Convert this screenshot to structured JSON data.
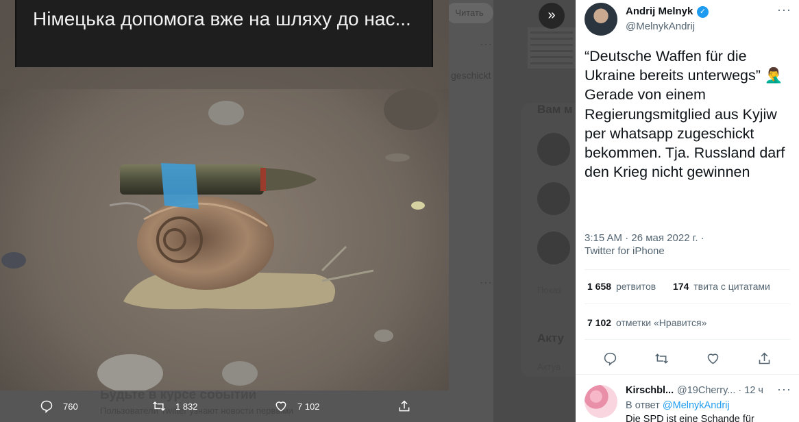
{
  "background": {
    "read_button": "Читать",
    "sidebar_heading": "Вам м",
    "trends_heading": "Акту",
    "fragment_1": "Показ",
    "fragment_2": "Актуа",
    "fragment_3": "geschickt",
    "bottom_title": "Будьте в курсе событий",
    "bottom_sub": "Пользователи Twitter узнают новости первыми"
  },
  "media": {
    "caption": "Німецька допомога вже на шляху до нас...",
    "image_icon": "snail-with-bullet-photo",
    "actions": {
      "reply_count": "760",
      "retweet_count": "1 832",
      "like_count": "7 102"
    }
  },
  "close_icon": "double-chevron-right-icon",
  "tweet": {
    "author_name": "Andrij Melnyk",
    "author_handle": "@MelnykAndrij",
    "verified": true,
    "text": "“Deutsche Waffen für die Ukraine bereits unterwegs” 🤦‍♂️\nGerade von einem Regierungsmitglied aus Kyjiw per whatsapp zugeschickt bekommen. Tja. Russland darf den Krieg nicht gewinnen",
    "time": "3:15 AM · 26 мая 2022 г. ·",
    "source": "Twitter for iPhone",
    "retweets_value": "1 658",
    "retweets_label": "ретвитов",
    "quotes_value": "174",
    "quotes_label": "твита с цитатами",
    "likes_value": "7 102",
    "likes_label": "отметки «Нравится»"
  },
  "reply": {
    "author_name": "Kirschbl...",
    "author_handle": "@19Cherry...",
    "time": "· 12 ч",
    "in_reply_prefix": "В ответ",
    "in_reply_handle": "@MelnykAndrij",
    "text": "Die SPD ist eine Schande für"
  },
  "colors": {
    "accent": "#1d9bf0",
    "secondary_text": "#536471",
    "primary_text": "#0f1419"
  }
}
